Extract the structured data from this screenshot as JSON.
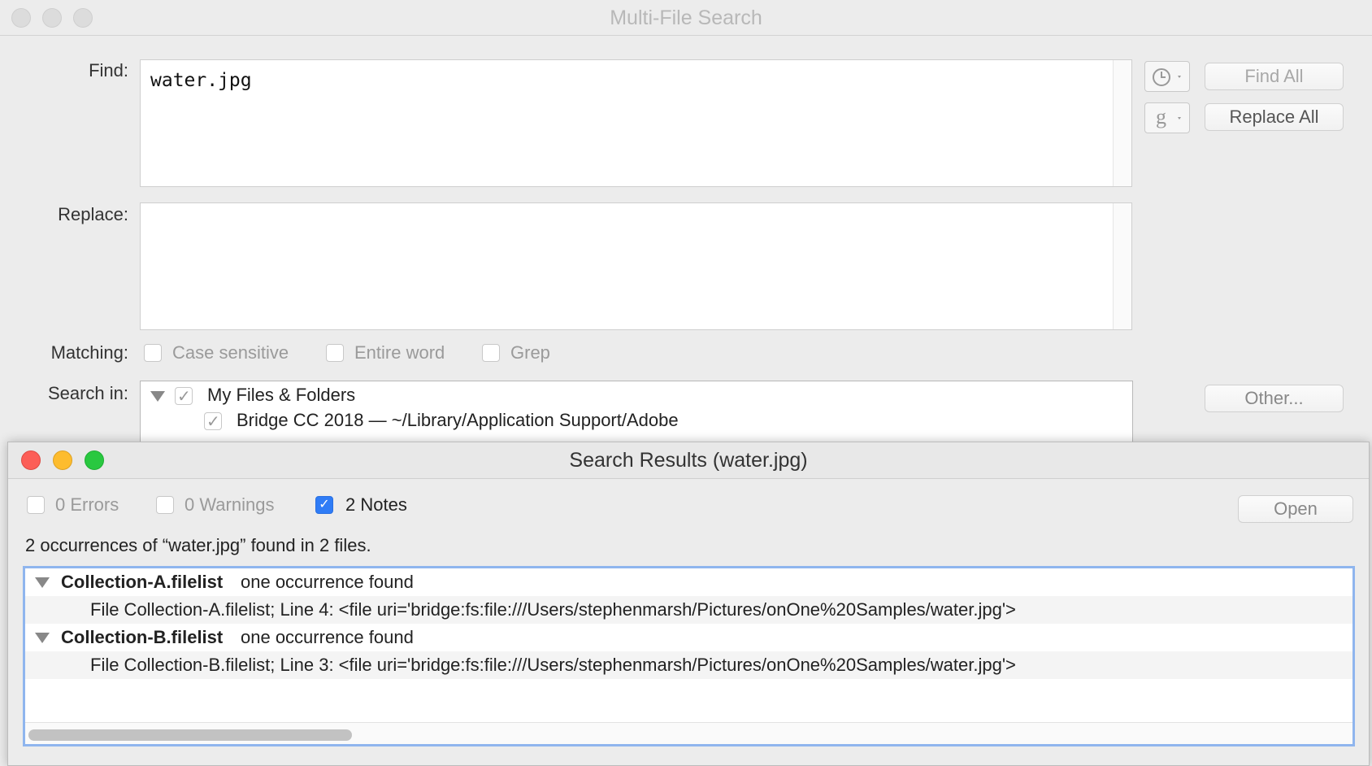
{
  "window": {
    "title": "Multi-File Search"
  },
  "find": {
    "label": "Find:",
    "value": "water.jpg"
  },
  "replace": {
    "label": "Replace:",
    "value": ""
  },
  "buttons": {
    "find_all": "Find All",
    "replace_all": "Replace All",
    "other": "Other...",
    "grep_glyph": "g"
  },
  "matching": {
    "label": "Matching:",
    "options": [
      {
        "label": "Case sensitive",
        "checked": false
      },
      {
        "label": "Entire word",
        "checked": false
      },
      {
        "label": "Grep",
        "checked": false
      }
    ]
  },
  "search_in": {
    "label": "Search in:",
    "items": [
      {
        "label": "My Files & Folders",
        "checked": true
      },
      {
        "label": "Bridge CC 2018 — ~/Library/Application Support/Adobe",
        "checked": true
      }
    ]
  },
  "results": {
    "title": "Search Results (water.jpg)",
    "filters": [
      {
        "label": "0 Errors",
        "checked": false
      },
      {
        "label": "0 Warnings",
        "checked": false
      },
      {
        "label": "2 Notes",
        "checked": true
      }
    ],
    "open_label": "Open",
    "summary": "2 occurrences of “water.jpg” found in 2 files.",
    "groups": [
      {
        "file": "Collection-A.filelist",
        "suffix": " one occurrence found",
        "line": "File Collection-A.filelist; Line 4:  <file uri='bridge:fs:file:///Users/stephenmarsh/Pictures/onOne%20Samples/water.jpg'>"
      },
      {
        "file": "Collection-B.filelist",
        "suffix": " one occurrence found",
        "line": "File Collection-B.filelist; Line 3:  <file uri='bridge:fs:file:///Users/stephenmarsh/Pictures/onOne%20Samples/water.jpg'>"
      }
    ]
  }
}
